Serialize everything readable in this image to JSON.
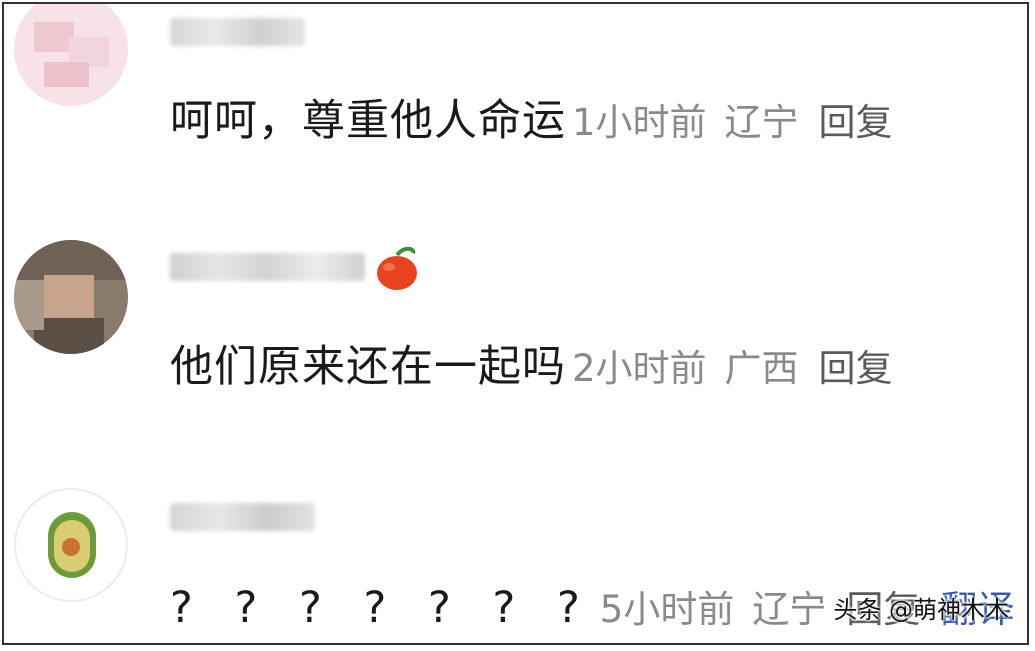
{
  "comments": [
    {
      "text": "呵呵，尊重他人命运",
      "time": "1小时前",
      "location": "辽宁",
      "reply_label": "回复"
    },
    {
      "text": "他们原来还在一起吗",
      "time": "2小时前",
      "location": "广西",
      "reply_label": "回复",
      "badge_icon": "apple-icon"
    },
    {
      "text": "? ? ? ? ? ? ?",
      "time": "5小时前",
      "location": "辽宁",
      "reply_label": "回复",
      "translate_label": "翻译"
    }
  ],
  "watermark": "头条 @萌神木木",
  "colors": {
    "text": "#1a1a1a",
    "meta": "#8a8a8a",
    "reply": "#5a5a5a",
    "translate": "#3b5aa8"
  }
}
